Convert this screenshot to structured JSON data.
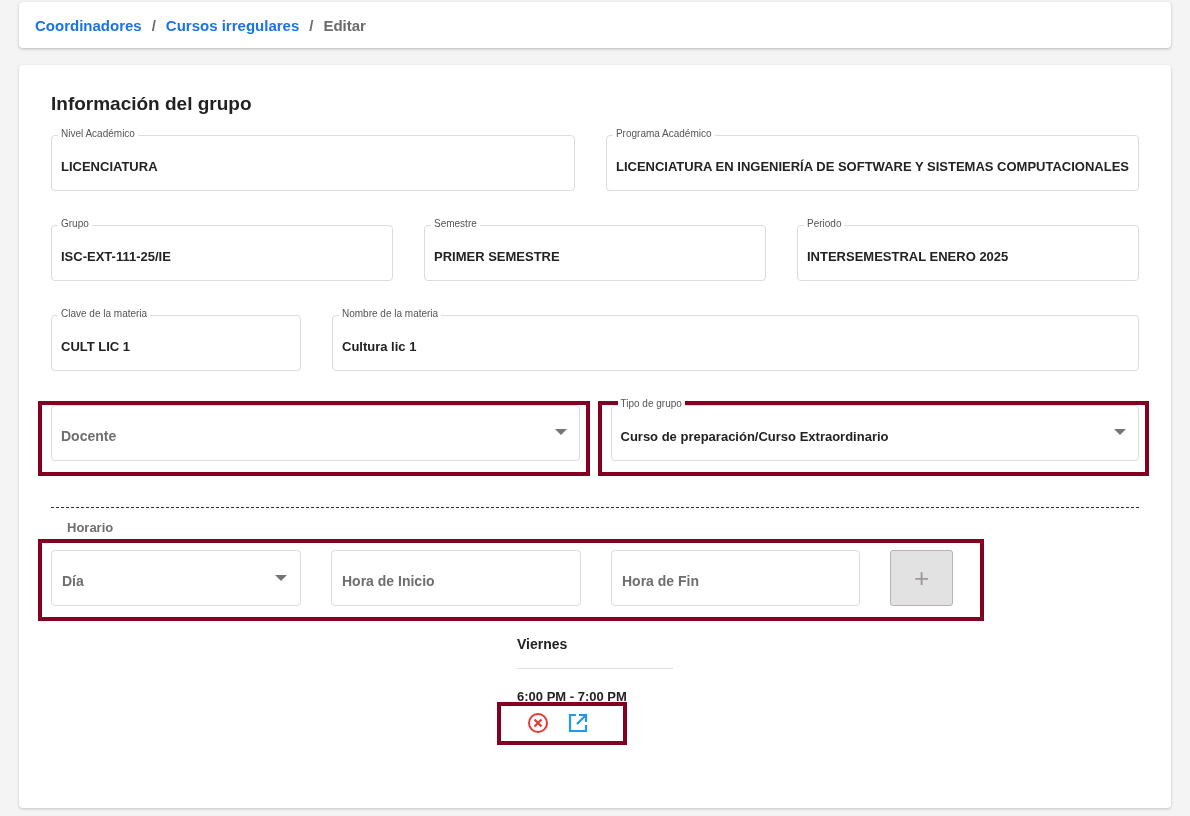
{
  "breadcrumb": [
    {
      "label": "Coordinadores",
      "kind": "link"
    },
    {
      "label": "/",
      "kind": "separator"
    },
    {
      "label": "Cursos irregulares",
      "kind": "link"
    },
    {
      "label": "/",
      "kind": "separator"
    },
    {
      "label": "Editar",
      "kind": "current"
    }
  ],
  "section_title": "Información del grupo",
  "field_rows": [
    {
      "fields": [
        {
          "kind": "text",
          "label": "Nivel Académico",
          "value": "LICENCIATURA",
          "highlighted": false
        },
        {
          "kind": "text",
          "label": "Programa Académico",
          "value": "LICENCIATURA EN INGENIERÍA DE SOFTWARE Y SISTEMAS COMPUTACIONALES",
          "highlighted": false
        }
      ]
    },
    {
      "fields": [
        {
          "kind": "text",
          "label": "Grupo",
          "value": "ISC-EXT-111-25/IE",
          "highlighted": false
        },
        {
          "kind": "text",
          "label": "Semestre",
          "value": "PRIMER SEMESTRE",
          "highlighted": false
        },
        {
          "kind": "text",
          "label": "Periodo",
          "value": "INTERSEMESTRAL ENERO 2025",
          "highlighted": false
        }
      ]
    },
    {
      "fields": [
        {
          "kind": "text",
          "label": "Clave de la materia",
          "value": "CULT LIC 1",
          "highlighted": false
        },
        {
          "kind": "text",
          "label": "Nombre de la materia",
          "value": "Cultura lic 1",
          "highlighted": false
        }
      ]
    },
    {
      "fields": [
        {
          "kind": "select",
          "placeholder": "Docente",
          "highlighted": true
        },
        {
          "kind": "select",
          "label": "Tipo de grupo",
          "value": "Curso de preparación/Curso Extraordinario",
          "highlighted": true
        }
      ]
    }
  ],
  "schedule": {
    "title": "Horario",
    "highlighted": true,
    "inputs": [
      {
        "kind": "select",
        "placeholder": "Día"
      },
      {
        "kind": "text",
        "placeholder": "Hora de Inicio"
      },
      {
        "kind": "text",
        "placeholder": "Hora de Fin"
      }
    ],
    "add_button": {
      "label": "+",
      "disabled": true
    },
    "entries": [
      {
        "day": "Viernes",
        "time": "6:00 PM - 7:00 PM",
        "actions_highlighted": true
      }
    ]
  }
}
